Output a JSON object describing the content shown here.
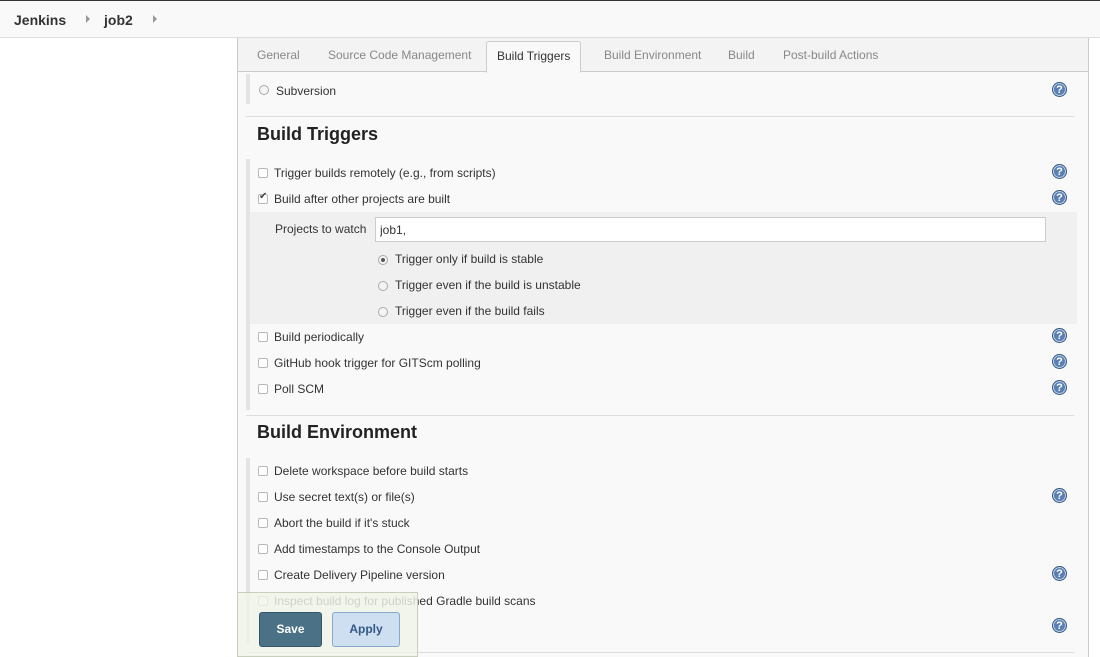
{
  "breadcrumb": {
    "root": "Jenkins",
    "job": "job2"
  },
  "tabs": [
    {
      "label": "General"
    },
    {
      "label": "Source Code Management"
    },
    {
      "label": "Build Triggers"
    },
    {
      "label": "Build Environment"
    },
    {
      "label": "Build"
    },
    {
      "label": "Post-build Actions"
    }
  ],
  "active_tab": "Build Triggers",
  "scm": {
    "subversion_label": "Subversion"
  },
  "build_triggers": {
    "heading": "Build Triggers",
    "options": [
      {
        "label": "Trigger builds remotely (e.g., from scripts)",
        "checked": false
      },
      {
        "label": "Build after other projects are built",
        "checked": true
      },
      {
        "label": "Build periodically",
        "checked": false
      },
      {
        "label": "GitHub hook trigger for GITScm polling",
        "checked": false
      },
      {
        "label": "Poll SCM",
        "checked": false
      }
    ],
    "projects_to_watch_label": "Projects to watch",
    "projects_to_watch_value": "job1,",
    "radios": [
      {
        "label": "Trigger only if build is stable",
        "selected": true
      },
      {
        "label": "Trigger even if the build is unstable",
        "selected": false
      },
      {
        "label": "Trigger even if the build fails",
        "selected": false
      }
    ]
  },
  "build_environment": {
    "heading": "Build Environment",
    "options": [
      {
        "label": "Delete workspace before build starts",
        "checked": false
      },
      {
        "label": "Use secret text(s) or file(s)",
        "checked": false
      },
      {
        "label": "Abort the build if it's stuck",
        "checked": false
      },
      {
        "label": "Add timestamps to the Console Output",
        "checked": false
      },
      {
        "label": "Create Delivery Pipeline version",
        "checked": false
      },
      {
        "label": "Inspect build log for published Gradle build scans",
        "checked": false
      }
    ]
  },
  "help_icon_glyph": "?",
  "actions": {
    "save_label": "Save",
    "apply_label": "Apply"
  }
}
